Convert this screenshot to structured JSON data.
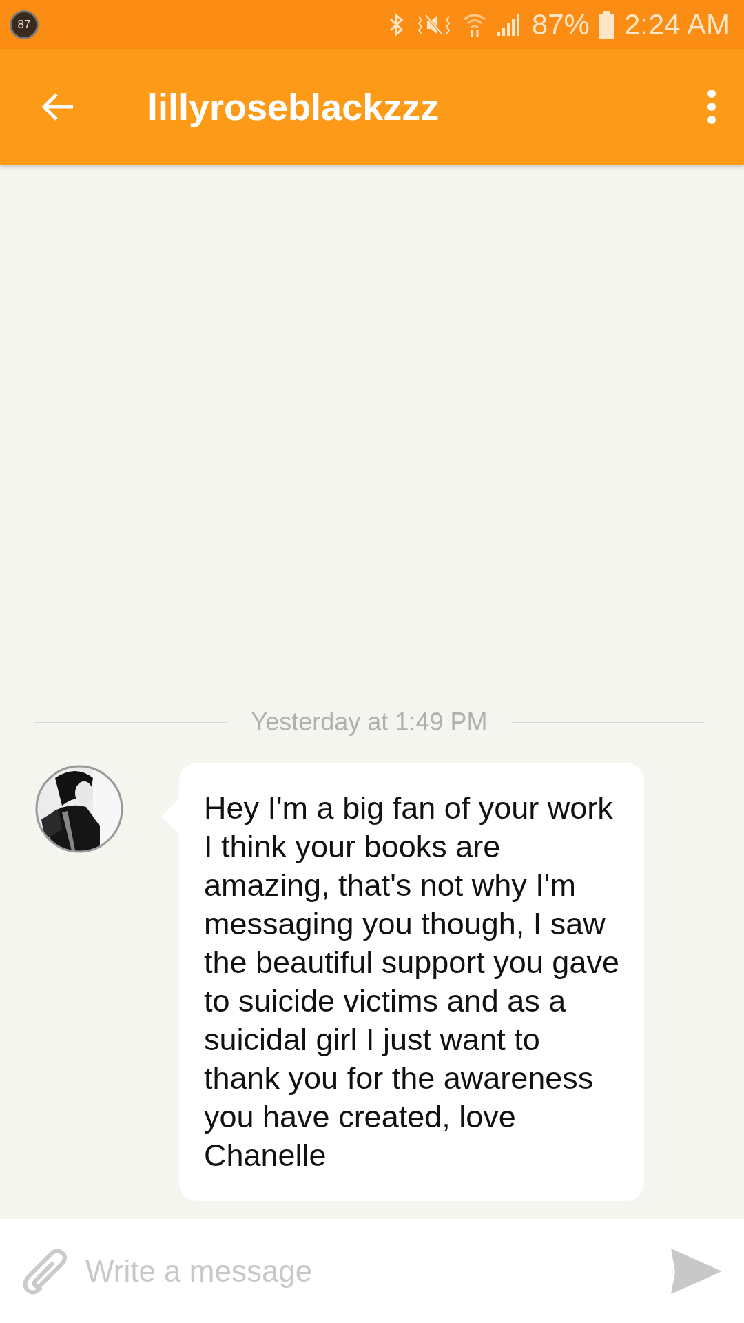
{
  "status_bar": {
    "notification_badge": "87",
    "battery_percent": "87%",
    "time": "2:24 AM"
  },
  "app_bar": {
    "title": "lillyroseblackzzz"
  },
  "conversation": {
    "timestamp": "Yesterday at 1:49 PM",
    "messages": [
      {
        "kind": "incoming",
        "text": "Hey I'm a big fan of your work I think your books are amazing, that's not why I'm messaging you though, I saw the beautiful support you gave to suicide victims and as a suicidal girl I just want to thank you for the awareness you have created, love Chanelle"
      }
    ]
  },
  "composer": {
    "placeholder": "Write a message"
  }
}
